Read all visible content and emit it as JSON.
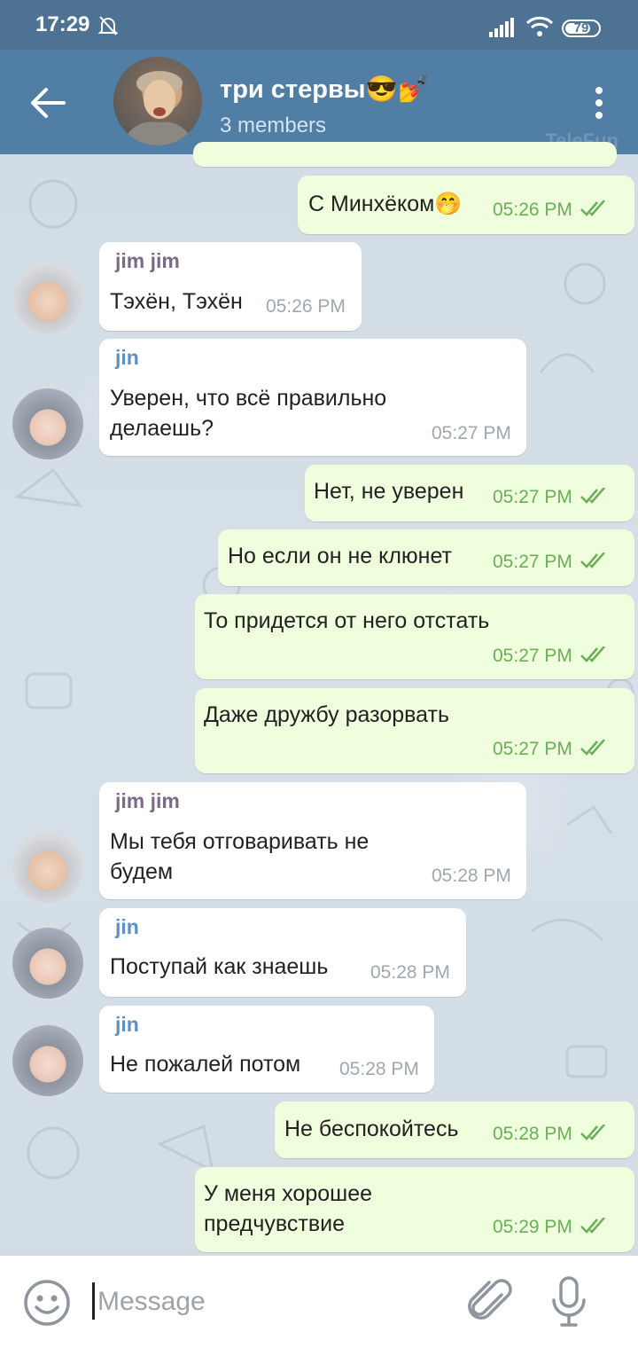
{
  "status_bar": {
    "time": "17:29",
    "battery": "79",
    "battery_level": 0.79
  },
  "header": {
    "title": "три стервы😎💅",
    "subtitle": "3 members",
    "watermark": "TeleFun"
  },
  "messages": [
    {
      "text": "С Минхёком🤭",
      "time": "05:26 PM"
    },
    {
      "sender": "jim jim",
      "text": "Тэхён, Тэхён",
      "time": "05:26 PM"
    },
    {
      "sender": "jin",
      "text": "Уверен, что всё правильно\nделаешь?",
      "time": "05:27 PM"
    },
    {
      "text": "Нет, не уверен",
      "time": "05:27 PM"
    },
    {
      "text": "Но если он не клюнет",
      "time": "05:27 PM"
    },
    {
      "text": "То придется от него отстать",
      "time": "05:27 PM"
    },
    {
      "text": "Даже дружбу разорвать",
      "time": "05:27 PM"
    },
    {
      "sender": "jim jim",
      "text": "Мы тебя отговаривать не\nбудем",
      "time": "05:28 PM"
    },
    {
      "sender": "jin",
      "text": "Поступай как знаешь",
      "time": "05:28 PM"
    },
    {
      "sender": "jin",
      "text": "Не пожалей потом",
      "time": "05:28 PM"
    },
    {
      "text": "Не беспокойтесь",
      "time": "05:28 PM"
    },
    {
      "text": "У меня хорошее\nпредчувствие",
      "time": "05:29 PM"
    }
  ],
  "input": {
    "placeholder": "Message"
  },
  "icons": {
    "back": "arrow-left-icon",
    "more": "more-vertical-icon",
    "emoji": "smiley-icon",
    "attach": "paperclip-icon",
    "mic": "microphone-icon",
    "read": "double-check-icon"
  },
  "colors": {
    "header": "#517ea5",
    "status_bar": "#4d7294",
    "outgoing_bubble": "#effedd",
    "incoming_bubble": "#ffffff",
    "check": "#6cae58"
  }
}
